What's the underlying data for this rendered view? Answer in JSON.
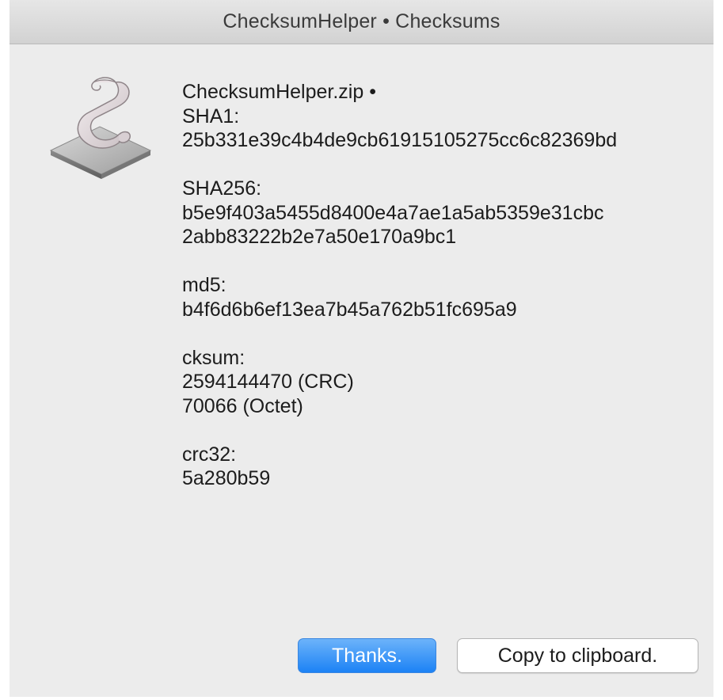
{
  "window": {
    "title": "ChecksumHelper • Checksums"
  },
  "icon": {
    "name": "script-scroll-icon"
  },
  "file": {
    "name_line": "ChecksumHelper.zip •"
  },
  "checksums": {
    "sha1": {
      "label": "SHA1:",
      "value": "25b331e39c4b4de9cb61915105275cc6c82369bd"
    },
    "sha256": {
      "label": "SHA256:",
      "line1": "b5e9f403a5455d8400e4a7ae1a5ab5359e31cbc",
      "line2": "2abb83222b2e7a50e170a9bc1"
    },
    "md5": {
      "label": "md5:",
      "value": "b4f6d6b6ef13ea7b45a762b51fc695a9"
    },
    "cksum": {
      "label": "cksum:",
      "crc": "2594144470 (CRC)",
      "octet": "70066 (Octet)"
    },
    "crc32": {
      "label": "crc32:",
      "value": "5a280b59"
    }
  },
  "buttons": {
    "primary_label": "Thanks.",
    "secondary_label": "Copy to clipboard."
  },
  "colors": {
    "accent": "#1c82f5",
    "window_bg": "#ececec"
  }
}
